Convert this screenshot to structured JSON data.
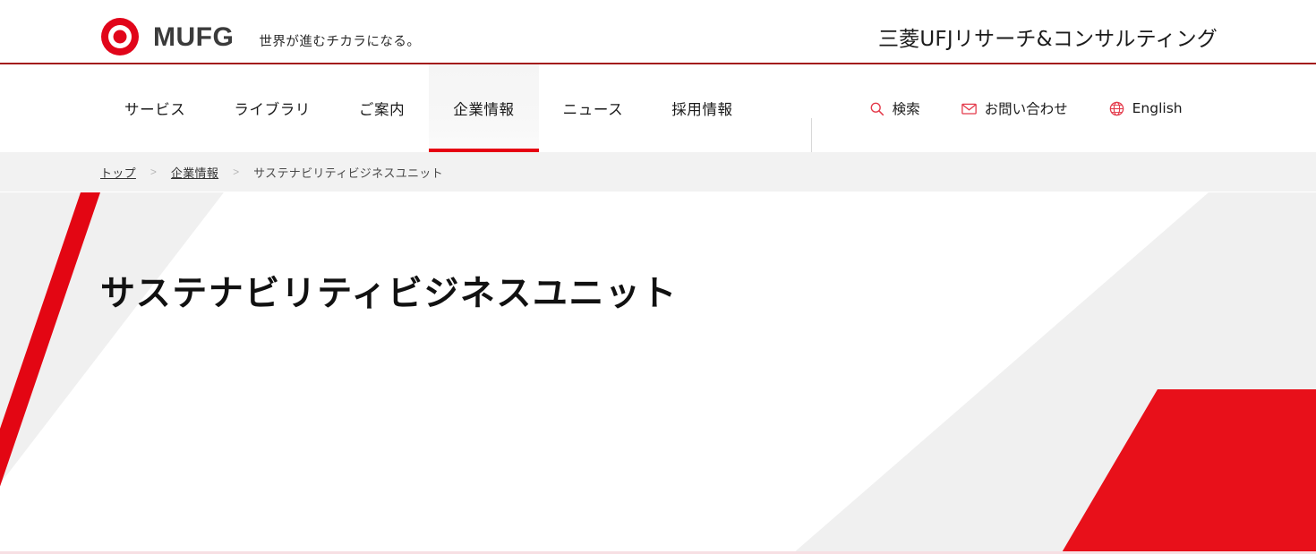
{
  "header": {
    "logo_icon": "mufg-target-logo",
    "logo_wordmark": "MUFG",
    "tagline": "世界が進むチカラになる。",
    "corporate_name": "三菱UFJリサーチ&コンサルティング",
    "accent_color": "#e60012",
    "rule_color": "#a31c1c"
  },
  "nav": {
    "items": [
      {
        "label": "サービス",
        "active": false
      },
      {
        "label": "ライブラリ",
        "active": false
      },
      {
        "label": "ご案内",
        "active": false
      },
      {
        "label": "企業情報",
        "active": true
      },
      {
        "label": "ニュース",
        "active": false
      },
      {
        "label": "採用情報",
        "active": false
      }
    ],
    "utilities": [
      {
        "label": "検索",
        "icon": "search-icon"
      },
      {
        "label": "お問い合わせ",
        "icon": "mail-icon"
      },
      {
        "label": "English",
        "icon": "globe-icon"
      }
    ]
  },
  "breadcrumb": {
    "items": [
      {
        "label": "トップ",
        "is_link": true
      },
      {
        "label": "企業情報",
        "is_link": true
      },
      {
        "label": "サステナビリティビジネスユニット",
        "is_link": false
      }
    ],
    "separator": ">"
  },
  "hero": {
    "title": "サステナビリティビジネスユニット",
    "background_color": "#f0f0f0",
    "band_color": "#ffffff",
    "stripe_color": "#e30613",
    "shape_color": "#e8101a",
    "bottom_line_color": "#f7dfe3"
  }
}
